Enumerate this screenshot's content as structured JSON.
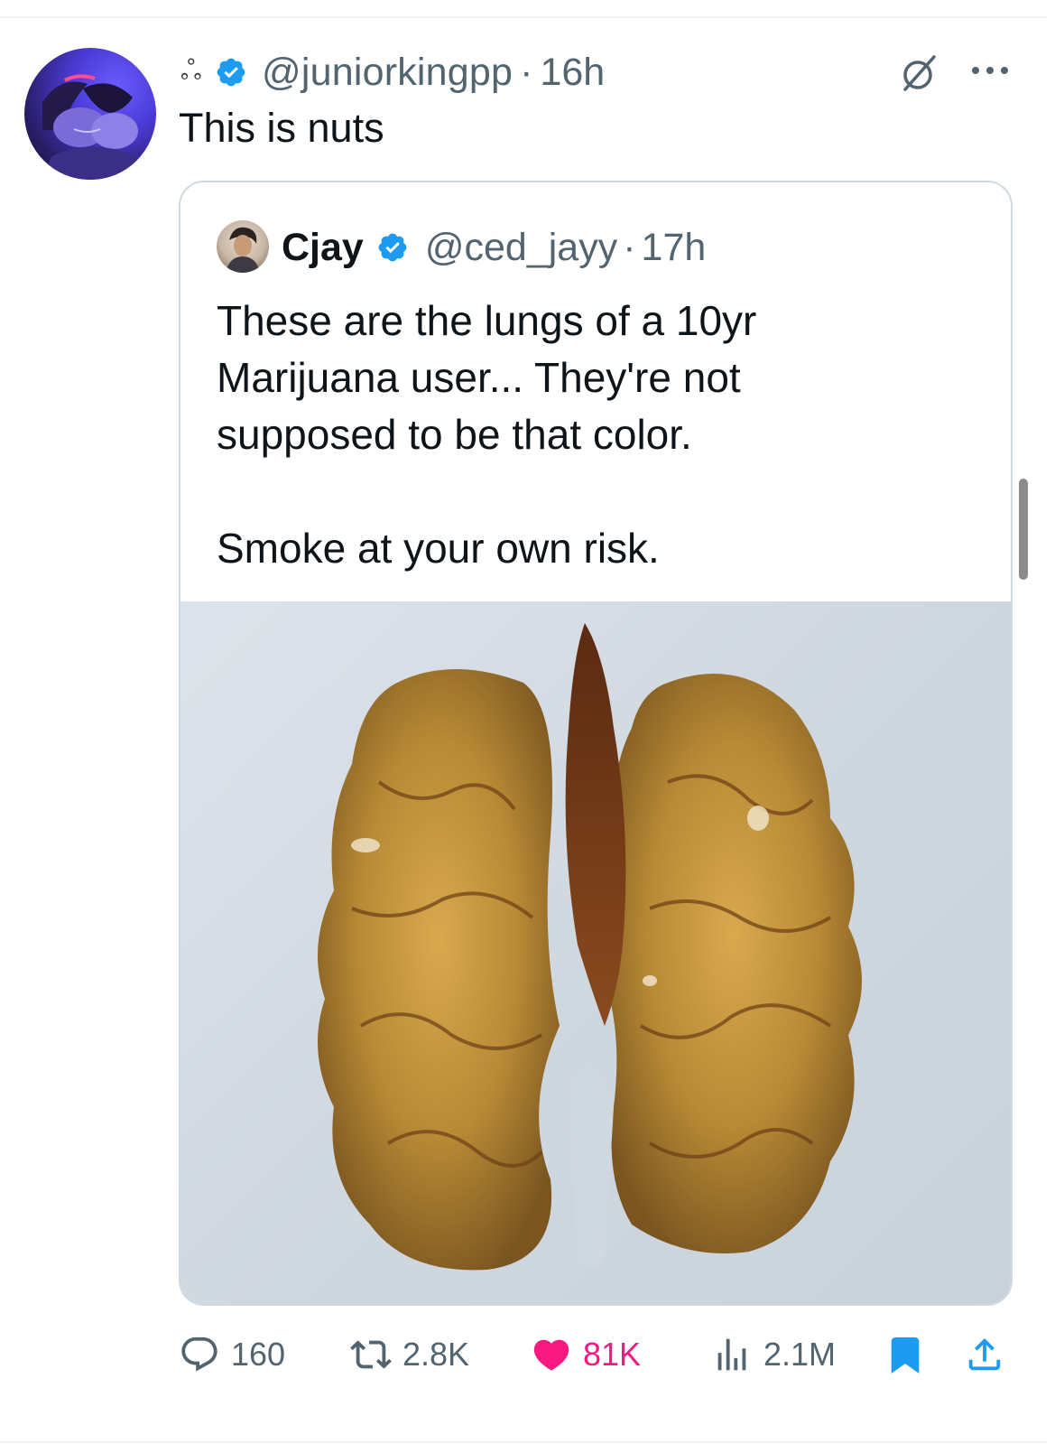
{
  "tweet": {
    "name_emoji": "ஃ",
    "handle": "@juniorkingpp",
    "separator": "·",
    "time": "16h",
    "text": "This is nuts"
  },
  "quote": {
    "name": "Cjay",
    "handle": "@ced_jayy",
    "separator": "·",
    "time": "17h",
    "lines": [
      "These are the lungs of a 10yr",
      "Marijuana user... They're not",
      "supposed to be that color."
    ],
    "closing_line": "Smoke at your own risk."
  },
  "actions": {
    "replies": "160",
    "retweets": "2.8K",
    "likes": "81K",
    "views": "2.1M"
  },
  "colors": {
    "verified": "#1d9bf0",
    "like": "#f91880",
    "bookmark": "#1d9bf0",
    "muted": "#536471"
  },
  "icons": [
    "verified-icon",
    "grok-icon",
    "more-icon",
    "reply-icon",
    "retweet-icon",
    "like-icon",
    "views-icon",
    "bookmark-icon",
    "share-icon"
  ]
}
